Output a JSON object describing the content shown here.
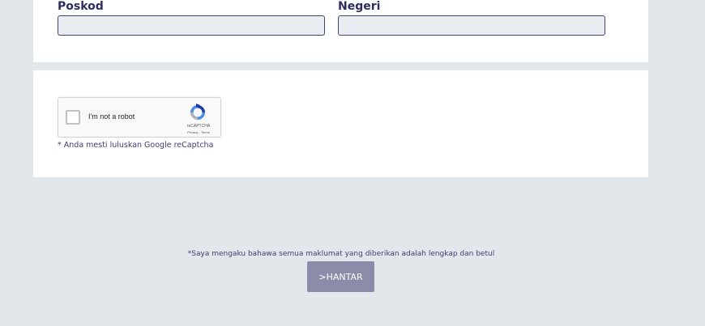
{
  "address": {
    "postcode": {
      "label": "Poskod",
      "value": ""
    },
    "state": {
      "label": "Negeri",
      "value": ""
    }
  },
  "recaptcha": {
    "label": "I'm not a robot",
    "brand": "reCAPTCHA",
    "links": "Privacy - Terms",
    "note": "* Anda mesti luluskan Google reCaptcha"
  },
  "footer": {
    "declaration": "*Saya mengaku bahawa semua maklumat yang diberikan adalah lengkap dan betul",
    "submit_label": ">HANTAR"
  },
  "colors": {
    "page_background": "#e1e7eb",
    "label_text": "#2e2e5e",
    "input_border": "#3f4778",
    "submit_button": "#8c8caa"
  }
}
